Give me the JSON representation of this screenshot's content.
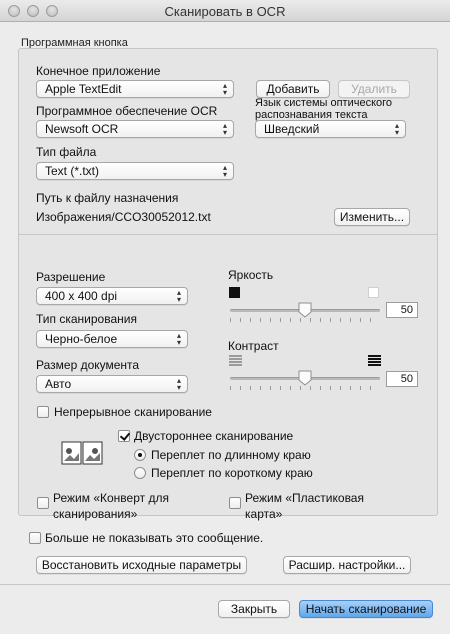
{
  "window": {
    "title": "Сканировать в OCR"
  },
  "group_label": "Программная кнопка",
  "target_app": {
    "label": "Конечное приложение",
    "value": "Apple TextEdit"
  },
  "buttons": {
    "add": "Добавить",
    "remove": "Удалить",
    "change": "Изменить...",
    "restore": "Восстановить исходные параметры",
    "advanced": "Расшир. настройки...",
    "close": "Закрыть",
    "start": "Начать сканирование"
  },
  "ocr_software": {
    "label": "Программное обеспечение OCR",
    "value": "Newsoft OCR"
  },
  "ocr_language": {
    "label": "Язык системы оптического распознавания текста",
    "value": "Шведский"
  },
  "file_type": {
    "label": "Тип файла",
    "value": "Text (*.txt)"
  },
  "destination": {
    "label": "Путь к файлу назначения",
    "value": "Изображения/CCO30052012.txt"
  },
  "resolution": {
    "label": "Разрешение",
    "value": "400 x 400  dpi"
  },
  "scan_type": {
    "label": "Тип сканирования",
    "value": "Черно-белое"
  },
  "doc_size": {
    "label": "Размер документа",
    "value": "Авто"
  },
  "brightness": {
    "label": "Яркость",
    "value": "50",
    "level": 50
  },
  "contrast": {
    "label": "Контраст",
    "value": "50",
    "level": 50
  },
  "continuous": {
    "label": "Непрерывное сканирование",
    "checked": false
  },
  "duplex": {
    "label": "Двустороннее сканирование",
    "checked": true,
    "long_edge": "Переплет по длинному краю",
    "short_edge": "Переплет по короткому краю",
    "selected": "long_edge"
  },
  "envelope": {
    "label_line1": "Режим «Конверт для",
    "label_line2": "сканирования»",
    "checked": false
  },
  "plastic": {
    "label_line1": "Режим «Пластиковая",
    "label_line2": "карта»",
    "checked": false
  },
  "dont_show": {
    "label": "Больше не показывать это сообщение.",
    "checked": false
  }
}
